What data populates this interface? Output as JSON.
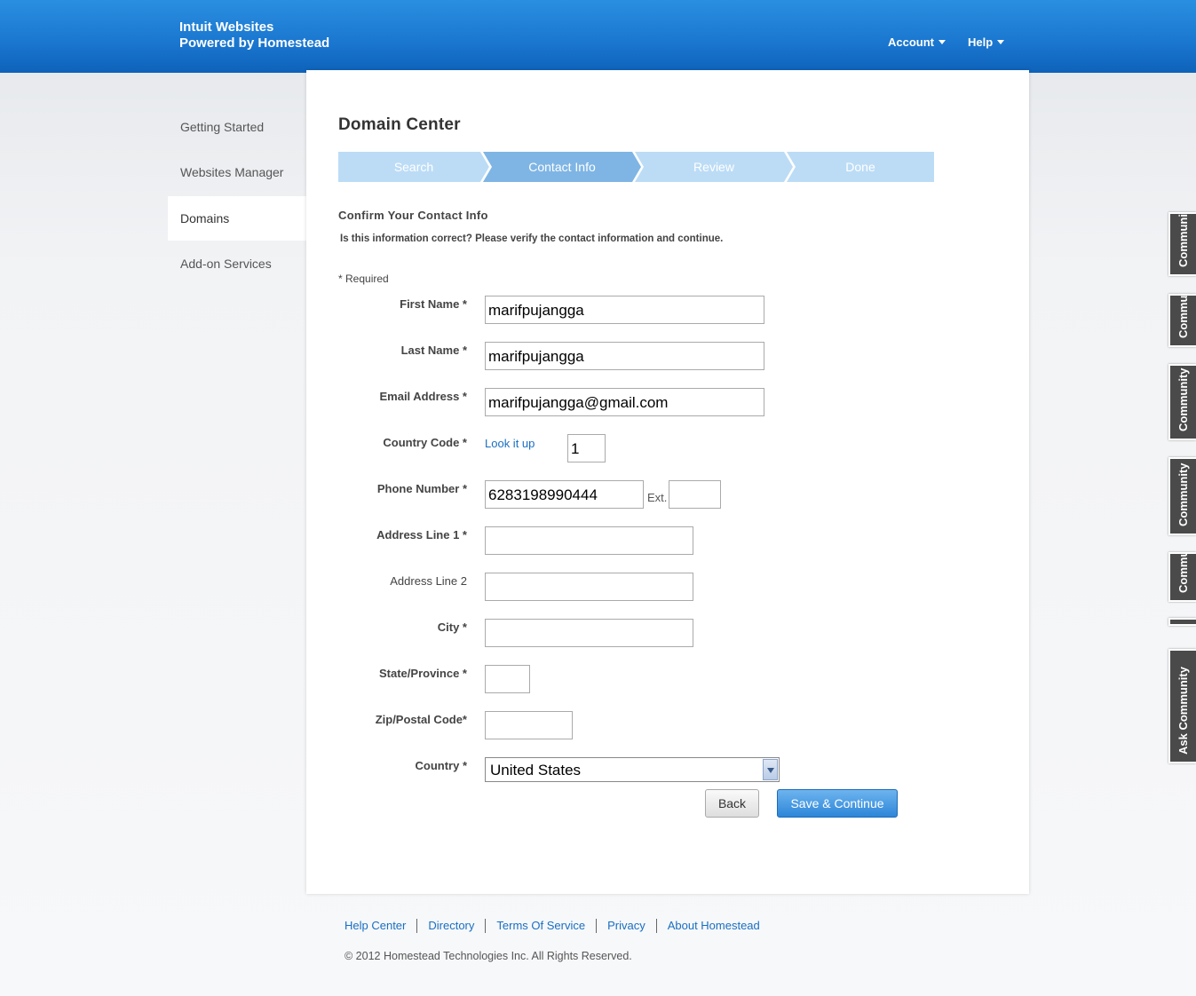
{
  "header": {
    "brand_line1": "Intuit Websites",
    "brand_line2": "Powered by Homestead",
    "account_label": "Account",
    "help_label": "Help"
  },
  "sidebar": {
    "items": [
      {
        "label": "Getting Started"
      },
      {
        "label": "Websites Manager"
      },
      {
        "label": "Domains"
      },
      {
        "label": "Add-on Services"
      }
    ]
  },
  "main": {
    "title": "Domain Center",
    "steps": [
      "Search",
      "Contact Info",
      "Review",
      "Done"
    ],
    "section_title": "Confirm Your Contact Info",
    "section_desc": "Is this information correct? Please verify the contact information and continue.",
    "required_note": "* Required",
    "fields": {
      "first_name": {
        "label": "First Name *",
        "value": "marifpujangga"
      },
      "last_name": {
        "label": "Last Name *",
        "value": "marifpujangga"
      },
      "email": {
        "label": "Email Address *",
        "value": "marifpujangga@gmail.com"
      },
      "country_code": {
        "label": "Country Code *",
        "link": "Look it up",
        "value": "1"
      },
      "phone": {
        "label": "Phone Number *",
        "value": "6283198990444",
        "ext_label": "Ext.",
        "ext_value": ""
      },
      "address1": {
        "label": "Address Line 1 *",
        "value": ""
      },
      "address2": {
        "label": "Address Line 2",
        "value": ""
      },
      "city": {
        "label": "City *",
        "value": ""
      },
      "state": {
        "label": "State/Province *",
        "value": ""
      },
      "zip": {
        "label": "Zip/Postal Code*",
        "value": ""
      },
      "country": {
        "label": "Country *",
        "value": "United States"
      }
    },
    "back_label": "Back",
    "save_label": "Save & Continue"
  },
  "footer": {
    "links": [
      "Help Center",
      "Directory",
      "Terms Of Service",
      "Privacy",
      "About Homestead"
    ],
    "copyright": "© 2012 Homestead Technologies Inc. All Rights Reserved."
  },
  "community_tabs": [
    "Community",
    "Community",
    "Community",
    "Community",
    "Community",
    "",
    "Ask Community"
  ],
  "colors": {
    "header_blue": "#1a76cf",
    "step_active": "#7fb5e4",
    "step_inactive": "#bcdcf6",
    "link_blue": "#1a6fc2",
    "save_button": "#2d86d8"
  }
}
